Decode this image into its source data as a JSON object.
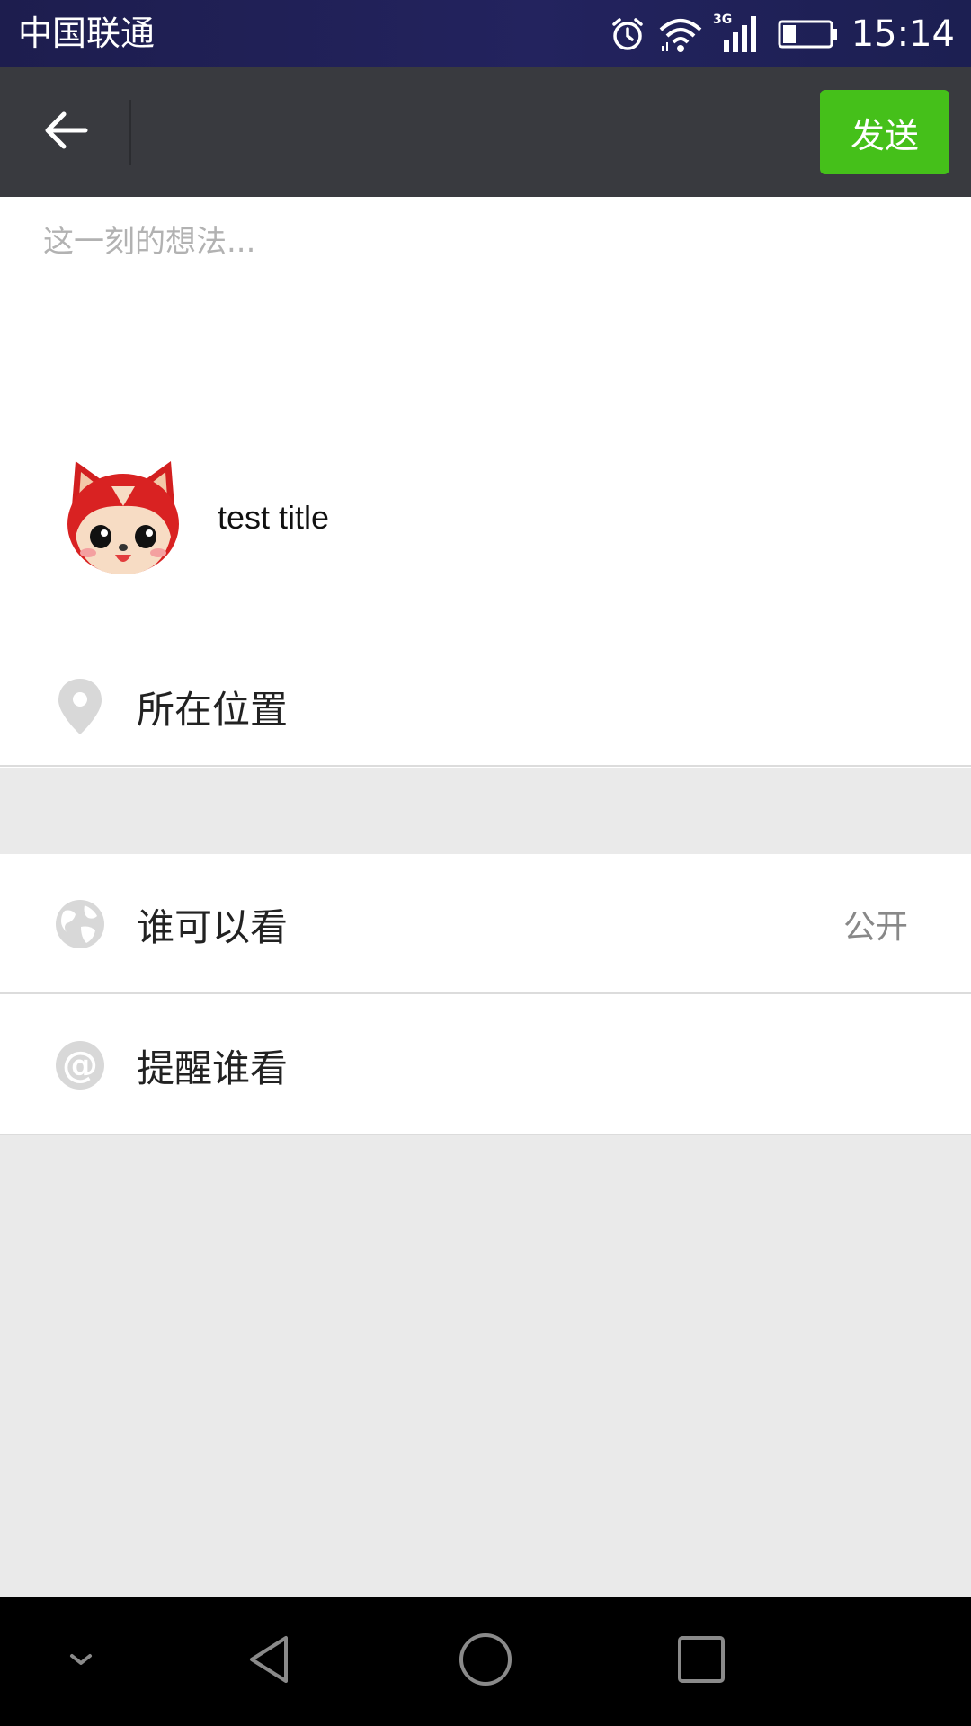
{
  "status_bar": {
    "carrier": "中国联通",
    "network_type": "3G",
    "time": "15:14",
    "icons": [
      "alarm-icon",
      "wifi-icon",
      "signal-icon",
      "battery-icon"
    ]
  },
  "header": {
    "back_icon": "arrow-left-icon",
    "send_label": "发送",
    "send_color": "#45c01a",
    "background": "#393a3f"
  },
  "compose": {
    "placeholder": "这一刻的想法...",
    "value": ""
  },
  "share_card": {
    "title": "test title",
    "thumbnail": "red-fox-cartoon-thumbnail"
  },
  "location": {
    "icon": "location-pin-icon",
    "label": "所在位置"
  },
  "settings": {
    "visibility": {
      "icon": "globe-icon",
      "label": "谁可以看",
      "value": "公开"
    },
    "mention": {
      "icon": "at-icon",
      "label": "提醒谁看"
    }
  },
  "nav_bar": {
    "icons": [
      "hide-keyboard-icon",
      "back-triangle-icon",
      "home-circle-icon",
      "recents-square-icon"
    ]
  }
}
